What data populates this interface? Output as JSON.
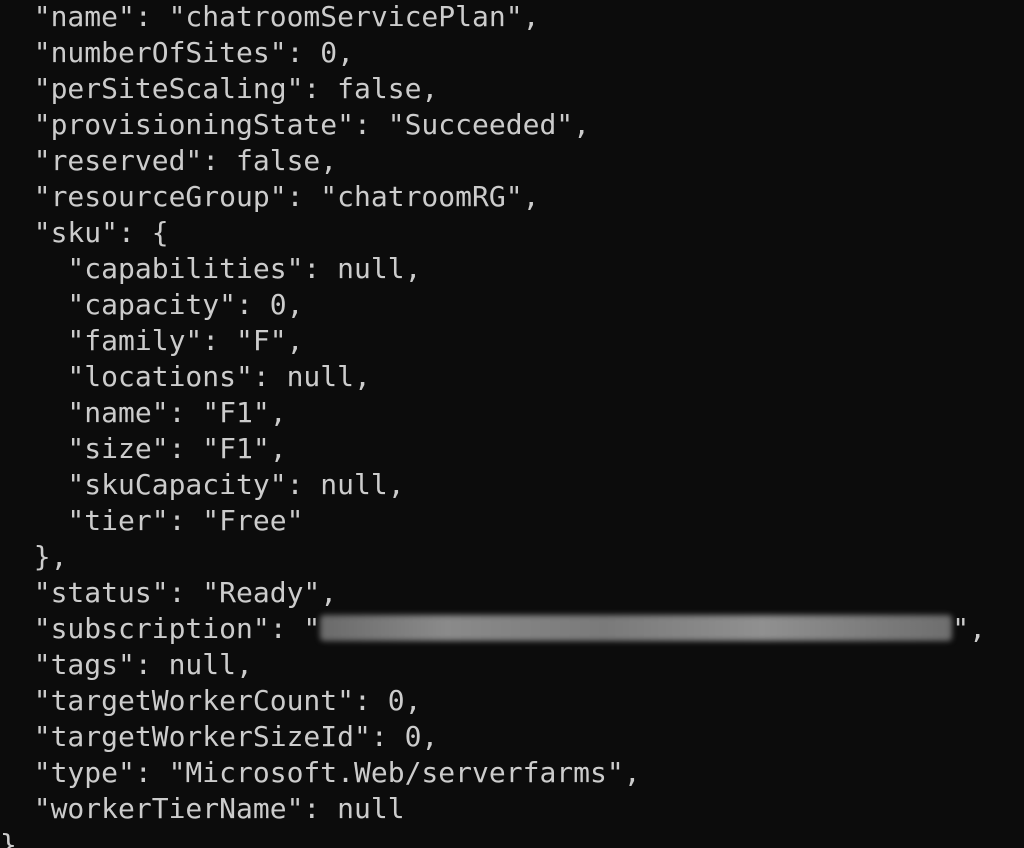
{
  "terminal": {
    "lines": [
      "  \"name\": \"chatroomServicePlan\",",
      "  \"numberOfSites\": 0,",
      "  \"perSiteScaling\": false,",
      "  \"provisioningState\": \"Succeeded\",",
      "  \"reserved\": false,",
      "  \"resourceGroup\": \"chatroomRG\",",
      "  \"sku\": {",
      "    \"capabilities\": null,",
      "    \"capacity\": 0,",
      "    \"family\": \"F\",",
      "    \"locations\": null,",
      "    \"name\": \"F1\",",
      "    \"size\": \"F1\",",
      "    \"skuCapacity\": null,",
      "    \"tier\": \"Free\"",
      "  },",
      "  \"status\": \"Ready\",",
      "  \"subscription\": \"",
      "  \"tags\": null,",
      "  \"targetWorkerCount\": 0,",
      "  \"targetWorkerSizeId\": 0,",
      "  \"type\": \"Microsoft.Web/serverfarms\",",
      "  \"workerTierName\": null",
      "}"
    ],
    "subscription_suffix": "\","
  }
}
